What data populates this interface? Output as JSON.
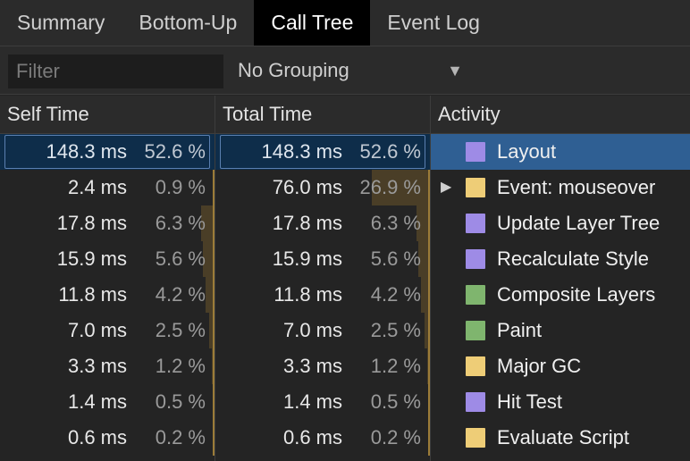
{
  "tabs": [
    {
      "label": "Summary",
      "active": false
    },
    {
      "label": "Bottom-Up",
      "active": false
    },
    {
      "label": "Call Tree",
      "active": true
    },
    {
      "label": "Event Log",
      "active": false
    }
  ],
  "toolbar": {
    "filter_placeholder": "Filter",
    "grouping_value": "No Grouping"
  },
  "columns": {
    "self_time": "Self Time",
    "total_time": "Total Time",
    "activity": "Activity"
  },
  "colors": {
    "rendering": "#9e8be6",
    "scripting": "#eecd77",
    "painting": "#7fb56e",
    "bar": "#4a3e27",
    "selected": "#2f5f93"
  },
  "rows": [
    {
      "self_ms": "148.3 ms",
      "self_pct": "52.6 %",
      "self_frac": 0.526,
      "total_ms": "148.3 ms",
      "total_pct": "52.6 %",
      "total_frac": 0.526,
      "activity": "Layout",
      "color": "#9e8be6",
      "expandable": false,
      "selected": true
    },
    {
      "self_ms": "2.4 ms",
      "self_pct": "0.9 %",
      "self_frac": 0.009,
      "total_ms": "76.0 ms",
      "total_pct": "26.9 %",
      "total_frac": 0.269,
      "activity": "Event: mouseover",
      "color": "#eecd77",
      "expandable": true,
      "selected": false
    },
    {
      "self_ms": "17.8 ms",
      "self_pct": "6.3 %",
      "self_frac": 0.063,
      "total_ms": "17.8 ms",
      "total_pct": "6.3 %",
      "total_frac": 0.063,
      "activity": "Update Layer Tree",
      "color": "#9e8be6",
      "expandable": false,
      "selected": false
    },
    {
      "self_ms": "15.9 ms",
      "self_pct": "5.6 %",
      "self_frac": 0.056,
      "total_ms": "15.9 ms",
      "total_pct": "5.6 %",
      "total_frac": 0.056,
      "activity": "Recalculate Style",
      "color": "#9e8be6",
      "expandable": false,
      "selected": false
    },
    {
      "self_ms": "11.8 ms",
      "self_pct": "4.2 %",
      "self_frac": 0.042,
      "total_ms": "11.8 ms",
      "total_pct": "4.2 %",
      "total_frac": 0.042,
      "activity": "Composite Layers",
      "color": "#7fb56e",
      "expandable": false,
      "selected": false
    },
    {
      "self_ms": "7.0 ms",
      "self_pct": "2.5 %",
      "self_frac": 0.025,
      "total_ms": "7.0 ms",
      "total_pct": "2.5 %",
      "total_frac": 0.025,
      "activity": "Paint",
      "color": "#7fb56e",
      "expandable": false,
      "selected": false
    },
    {
      "self_ms": "3.3 ms",
      "self_pct": "1.2 %",
      "self_frac": 0.012,
      "total_ms": "3.3 ms",
      "total_pct": "1.2 %",
      "total_frac": 0.012,
      "activity": "Major GC",
      "color": "#eecd77",
      "expandable": false,
      "selected": false
    },
    {
      "self_ms": "1.4 ms",
      "self_pct": "0.5 %",
      "self_frac": 0.005,
      "total_ms": "1.4 ms",
      "total_pct": "0.5 %",
      "total_frac": 0.005,
      "activity": "Hit Test",
      "color": "#9e8be6",
      "expandable": false,
      "selected": false
    },
    {
      "self_ms": "0.6 ms",
      "self_pct": "0.2 %",
      "self_frac": 0.002,
      "total_ms": "0.6 ms",
      "total_pct": "0.2 %",
      "total_frac": 0.002,
      "activity": "Evaluate Script",
      "color": "#eecd77",
      "expandable": false,
      "selected": false
    }
  ]
}
